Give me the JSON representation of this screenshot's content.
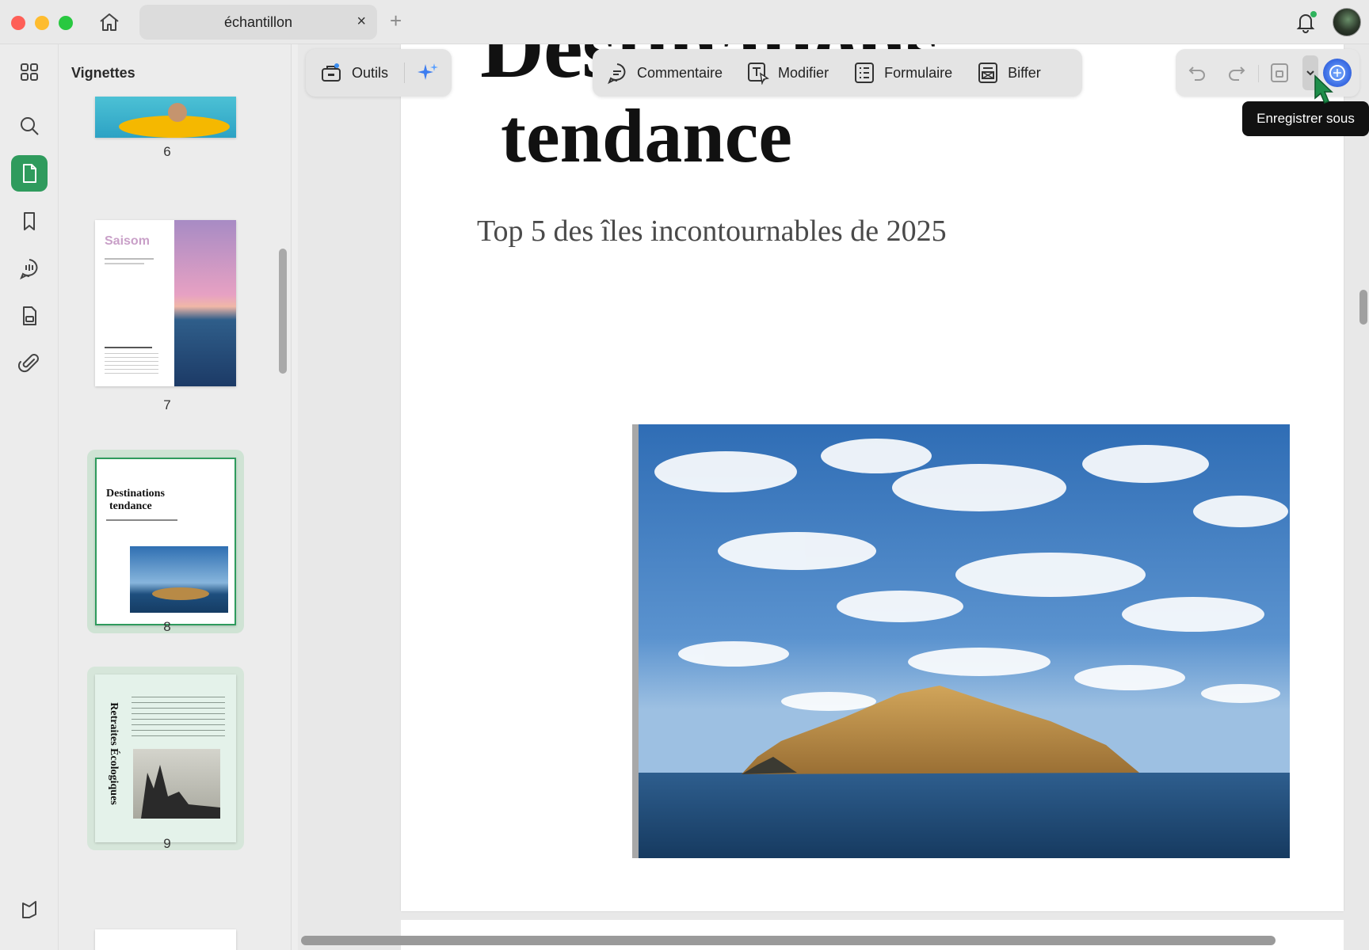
{
  "titlebar": {
    "tab_title": "échantillon",
    "tab_close": "×",
    "tab_add": "+"
  },
  "rail": {
    "items": [
      {
        "name": "apps-grid-icon",
        "active": false
      },
      {
        "name": "search-icon",
        "active": false
      },
      {
        "name": "pages-icon",
        "active": true
      },
      {
        "name": "bookmark-icon",
        "active": false
      },
      {
        "name": "comments-icon",
        "active": false
      },
      {
        "name": "stamp-icon",
        "active": false
      },
      {
        "name": "attachment-icon",
        "active": false
      }
    ],
    "bottom_icon": "theme-icon"
  },
  "thumbnails": {
    "title": "Vignettes",
    "pages": [
      {
        "number": "6"
      },
      {
        "number": "7",
        "heading": "Saisom"
      },
      {
        "number": "8",
        "heading_line1": "Destinations",
        "heading_line2": "tendance",
        "selected": true
      },
      {
        "number": "9",
        "heading": "Retraites Écologiques"
      }
    ]
  },
  "toolbar": {
    "tools_label": "Outils",
    "items": [
      {
        "label": "Commentaire",
        "icon": "comment-icon"
      },
      {
        "label": "Modifier",
        "icon": "edit-text-icon"
      },
      {
        "label": "Formulaire",
        "icon": "form-icon"
      },
      {
        "label": "Biffer",
        "icon": "redact-icon"
      }
    ]
  },
  "right_toolbar": {
    "tooltip": "Enregistrer sous"
  },
  "document": {
    "title_top": "Destinations",
    "title": "tendance",
    "subtitle": "Top 5 des îles incontournables de 2025"
  },
  "colors": {
    "accent": "#2f9b5d",
    "ai": "#3d6fe6"
  }
}
